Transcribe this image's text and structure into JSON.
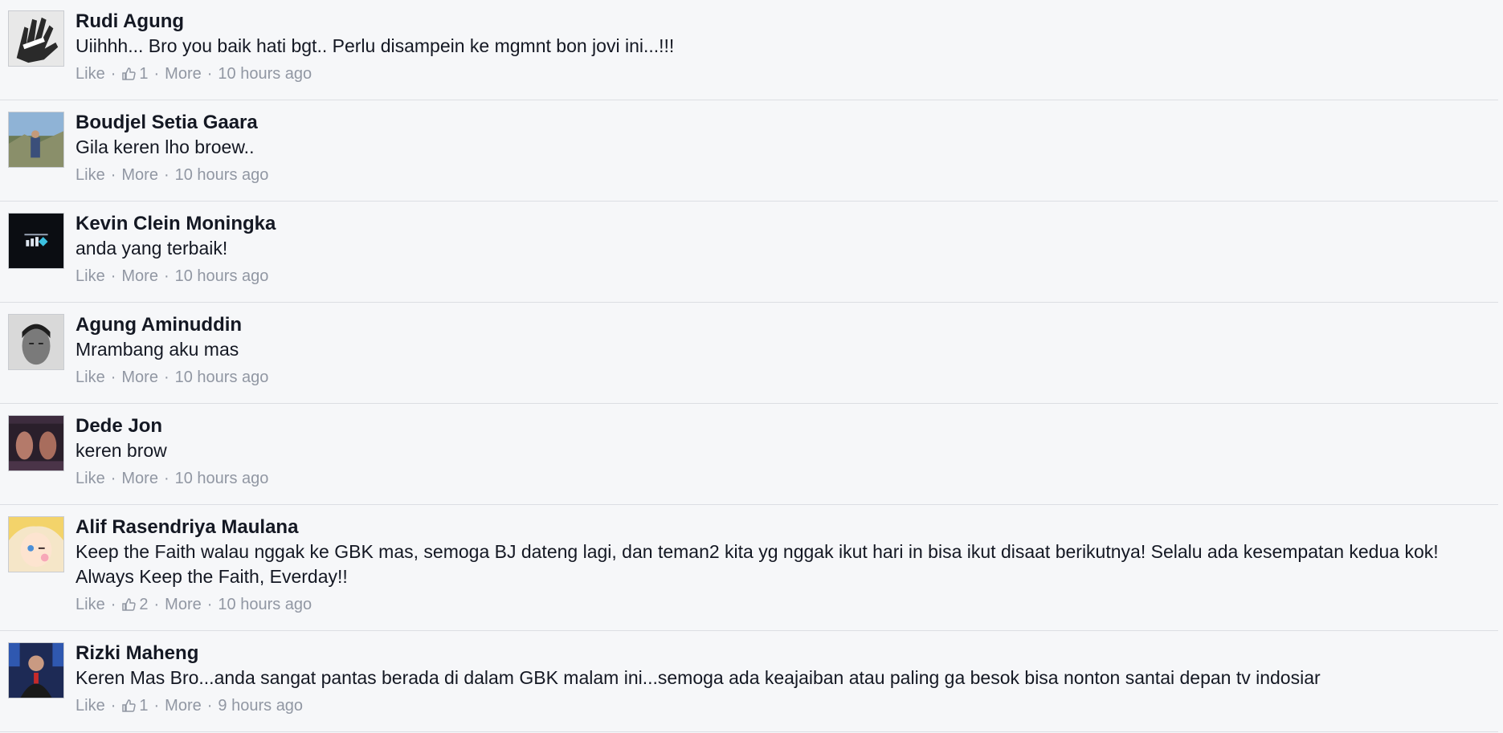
{
  "comments": [
    {
      "author": "Rudi Agung",
      "text": "Uiihhh... Bro you baik hati bgt.. Perlu disampein ke mgmnt bon jovi ini...!!!",
      "like_label": "Like",
      "like_count": "1",
      "more_label": "More",
      "time": "10 hours ago",
      "avatar": "hand-print-avatar"
    },
    {
      "author": "Boudjel Setia Gaara",
      "text": "Gila keren lho broew..",
      "like_label": "Like",
      "like_count": "",
      "more_label": "More",
      "time": "10 hours ago",
      "avatar": "outdoor-person-avatar"
    },
    {
      "author": "Kevin Clein Moningka",
      "text": "anda yang terbaik!",
      "like_label": "Like",
      "like_count": "",
      "more_label": "More",
      "time": "10 hours ago",
      "avatar": "dark-logo-avatar"
    },
    {
      "author": "Agung Aminuddin",
      "text": "Mrambang aku mas",
      "like_label": "Like",
      "like_count": "",
      "more_label": "More",
      "time": "10 hours ago",
      "avatar": "face-portrait-avatar"
    },
    {
      "author": "Dede Jon",
      "text": "keren brow",
      "like_label": "Like",
      "like_count": "",
      "more_label": "More",
      "time": "10 hours ago",
      "avatar": "poster-avatar"
    },
    {
      "author": "Alif Rasendriya Maulana",
      "text": "Keep the Faith walau nggak ke GBK mas, semoga BJ dateng lagi, dan teman2 kita yg nggak ikut hari in bisa ikut disaat berikutnya! Selalu ada kesempatan kedua kok! Always Keep the Faith, Everday!!",
      "like_label": "Like",
      "like_count": "2",
      "more_label": "More",
      "time": "10 hours ago",
      "avatar": "anime-character-avatar"
    },
    {
      "author": "Rizki Maheng",
      "text": "Keren Mas Bro...anda sangat pantas berada di dalam GBK malam ini...semoga ada keajaiban atau paling ga besok bisa nonton santai depan tv indosiar",
      "like_label": "Like",
      "like_count": "1",
      "more_label": "More",
      "time": "9 hours ago",
      "avatar": "tv-presenter-avatar"
    }
  ],
  "colors": {
    "background": "#f6f7f9",
    "text": "#141823",
    "meta": "#9197a3",
    "divider": "#dcdee3"
  }
}
